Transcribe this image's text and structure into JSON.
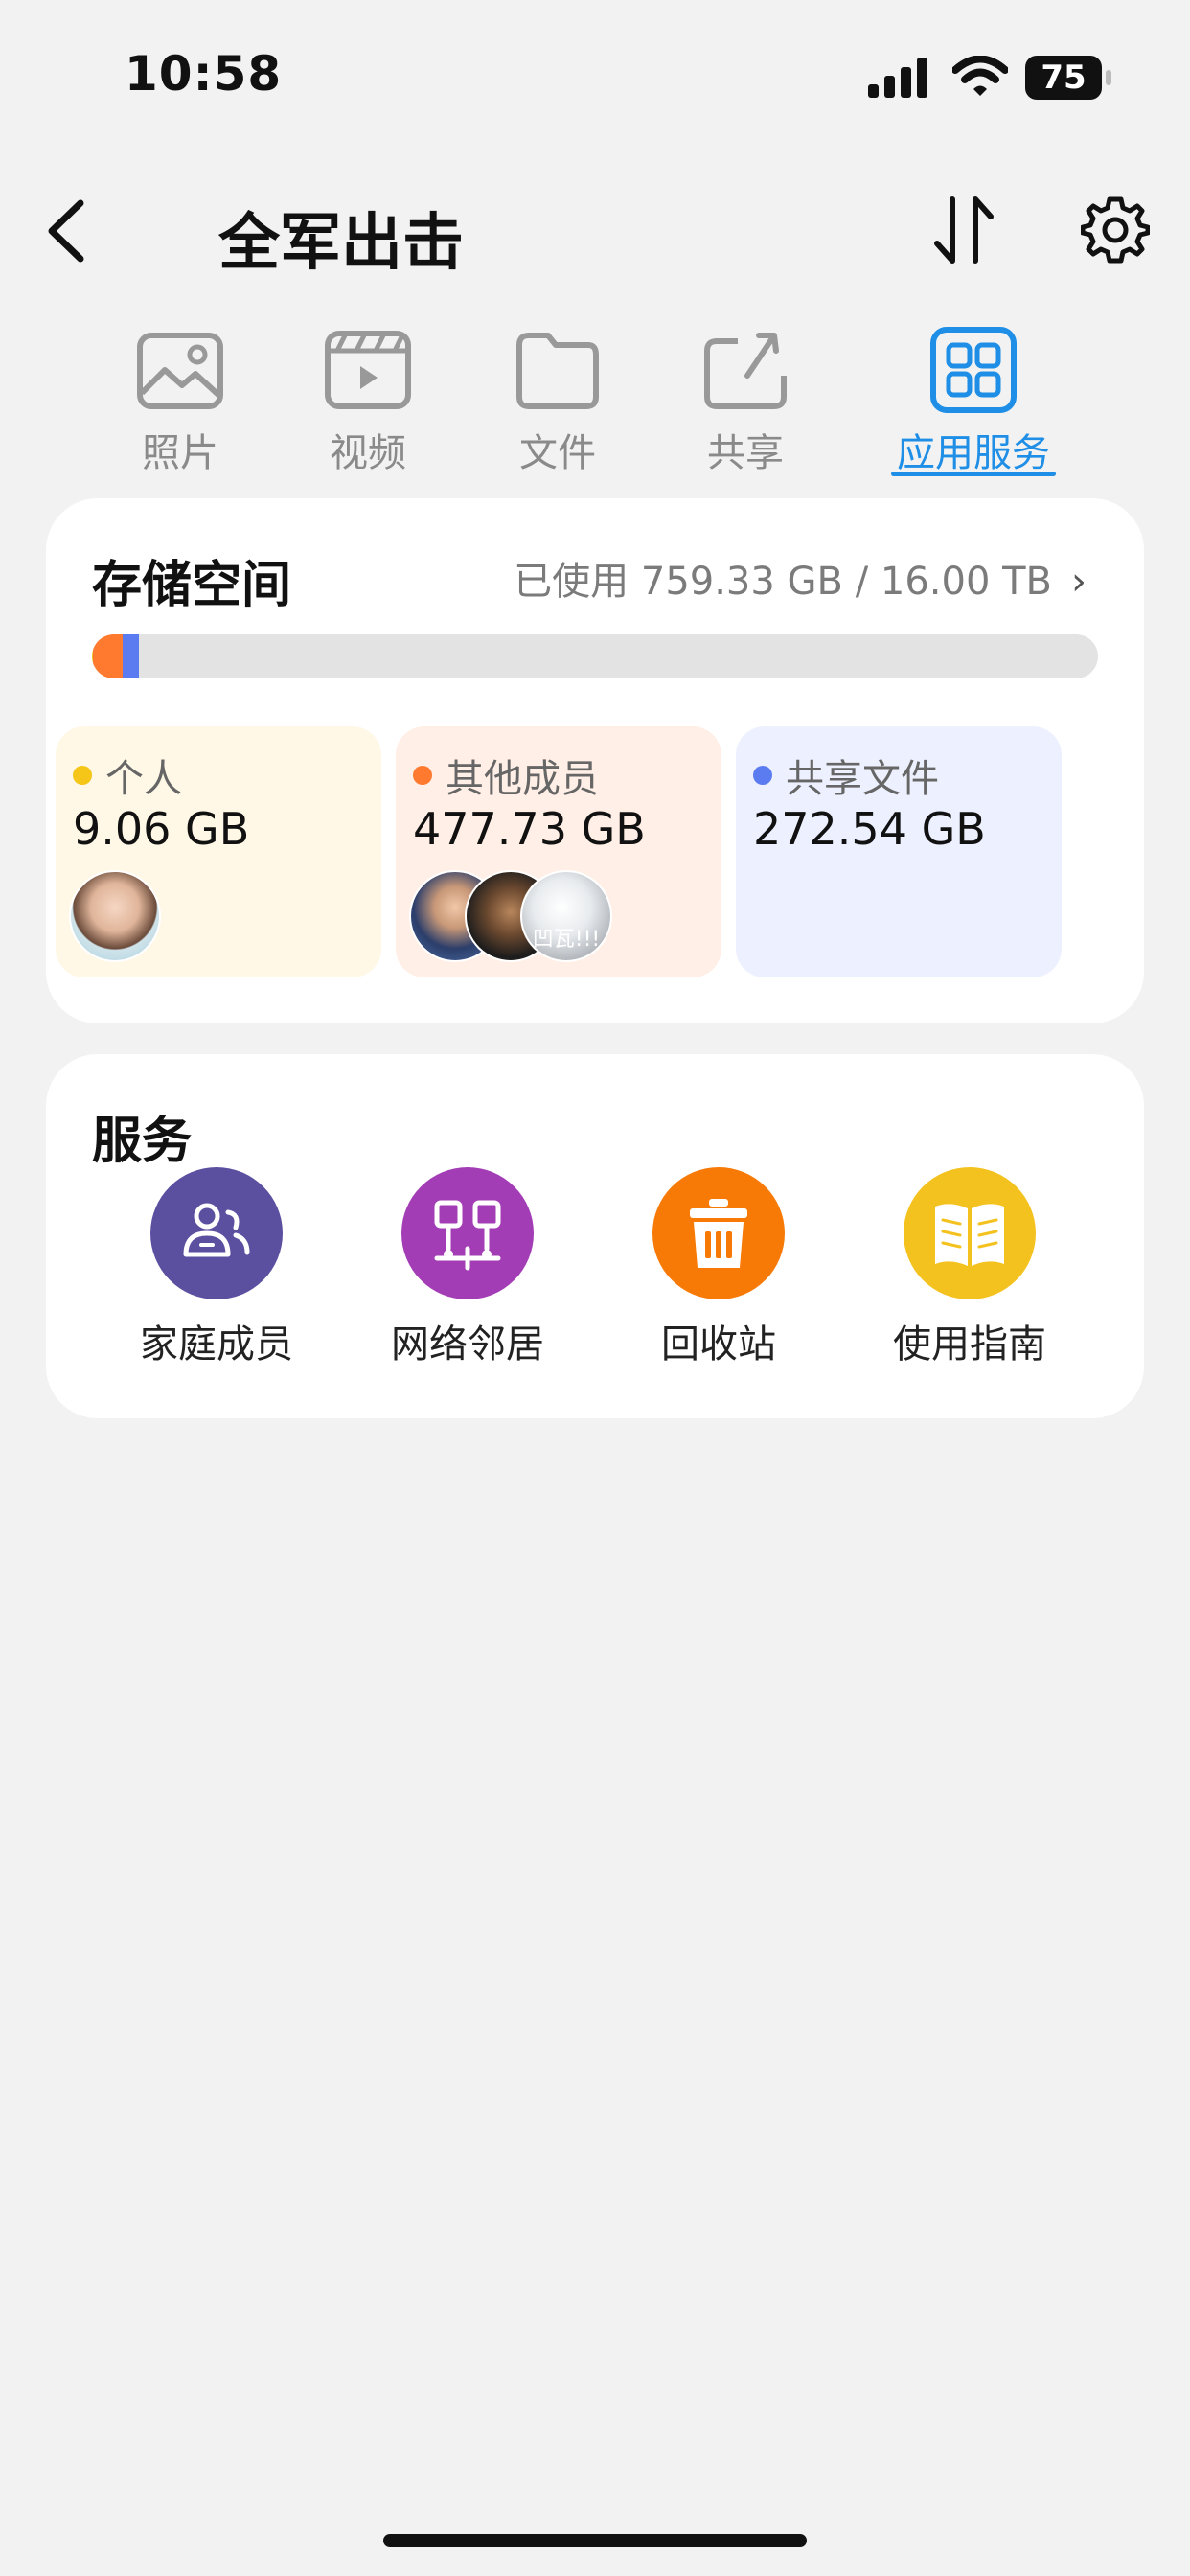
{
  "status_bar": {
    "time": "10:58",
    "battery": "75"
  },
  "header": {
    "title": "全军出击"
  },
  "tabs": [
    {
      "label": "照片",
      "icon": "photo-icon",
      "active": false
    },
    {
      "label": "视频",
      "icon": "video-icon",
      "active": false
    },
    {
      "label": "文件",
      "icon": "folder-icon",
      "active": false
    },
    {
      "label": "共享",
      "icon": "share-icon",
      "active": false
    },
    {
      "label": "应用服务",
      "icon": "apps-grid-icon",
      "active": true
    }
  ],
  "storage": {
    "title": "存储空间",
    "usage_text": "已使用 759.33 GB / 16.00 TB",
    "used_fraction": 0.047,
    "categories": [
      {
        "label": "个人",
        "value": "9.06 GB",
        "dot_color": "#f5c518",
        "bg": "#fff8e6"
      },
      {
        "label": "其他成员",
        "value": "477.73 GB",
        "dot_color": "#ff7a2e",
        "bg": "#ffefe6"
      },
      {
        "label": "共享文件",
        "value": "272.54 GB",
        "dot_color": "#5b7cf0",
        "bg": "#edf1ff"
      }
    ],
    "avatar_caption": "凹瓦!!!"
  },
  "services": {
    "title": "服务",
    "items": [
      {
        "label": "家庭成员",
        "icon": "family-members-icon",
        "color": "#5b4fa0"
      },
      {
        "label": "网络邻居",
        "icon": "network-neighbors-icon",
        "color": "#a33db6"
      },
      {
        "label": "回收站",
        "icon": "trash-icon",
        "color": "#f77a07"
      },
      {
        "label": "使用指南",
        "icon": "guide-book-icon",
        "color": "#f4c21f"
      }
    ]
  }
}
